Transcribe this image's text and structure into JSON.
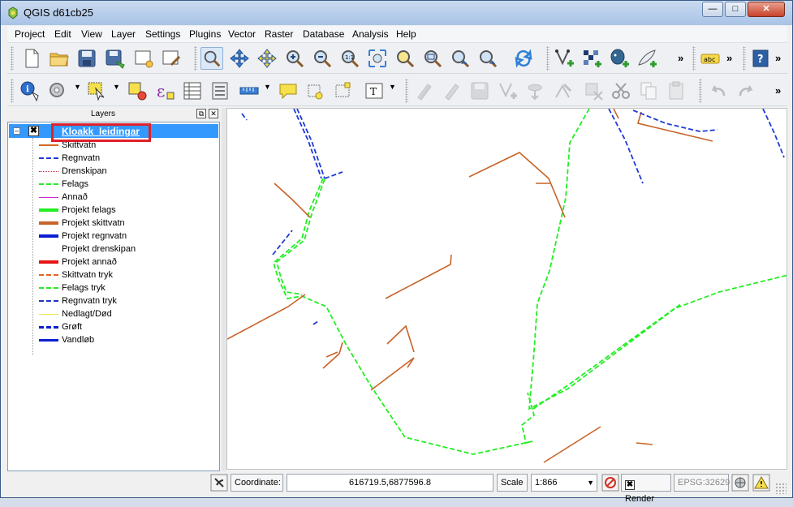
{
  "window": {
    "title": "QGIS d61cb25"
  },
  "menu": [
    "Project",
    "Edit",
    "View",
    "Layer",
    "Settings",
    "Plugins",
    "Vector",
    "Raster",
    "Database",
    "Analysis",
    "Help"
  ],
  "toolbar_more": "»",
  "toolbar_labels": {
    "label_tool": "abc",
    "help": "?",
    "text_annotation": "T"
  },
  "layers_panel": {
    "title": "Layers",
    "layer_name": "Kloakk_leidingar",
    "legend": [
      {
        "label": "Skittvatn",
        "color": "#d2691e",
        "style": "solid",
        "width": 2
      },
      {
        "label": "Regnvatn",
        "color": "#1f3ad6",
        "style": "dashed",
        "width": 2
      },
      {
        "label": "Drenskipan",
        "color": "#c8283c",
        "style": "dashdot",
        "width": 1
      },
      {
        "label": "Felags",
        "color": "#22ee22",
        "style": "dashed",
        "width": 2
      },
      {
        "label": "Annað",
        "color": "#c828c8",
        "style": "solid",
        "width": 1
      },
      {
        "label": "Projekt felags",
        "color": "#22ee22",
        "style": "solid",
        "width": 4
      },
      {
        "label": "Projekt skittvatn",
        "color": "#c86428",
        "style": "solid",
        "width": 4
      },
      {
        "label": "Projekt regnvatn",
        "color": "#0a1ed0",
        "style": "solid",
        "width": 4
      },
      {
        "label": "Projekt drenskipan",
        "color": "#ffffff",
        "style": "none",
        "width": 0
      },
      {
        "label": "Projekt annað",
        "color": "#e61414",
        "style": "solid",
        "width": 4
      },
      {
        "label": "Skittvatn tryk",
        "color": "#e6641e",
        "style": "dashed",
        "width": 2
      },
      {
        "label": "Felags tryk",
        "color": "#22ee22",
        "style": "dashed",
        "width": 2
      },
      {
        "label": "Regnvatn tryk",
        "color": "#1e32c8",
        "style": "dashed",
        "width": 2
      },
      {
        "label": "Nedlagt/Død",
        "color": "#f0e65a",
        "style": "solid",
        "width": 1
      },
      {
        "label": "Grøft",
        "color": "#0a1ed0",
        "style": "dashed",
        "width": 3
      },
      {
        "label": "Vandløb",
        "color": "#0a1ed0",
        "style": "solid",
        "width": 3
      }
    ]
  },
  "statusbar": {
    "coordinate_label": "Coordinate:",
    "coordinate_value": "616719.5,6877596.8",
    "scale_label": "Scale",
    "scale_value": "1:866",
    "render_label": "Render",
    "crs": "EPSG:32629"
  },
  "colors": {
    "selection": "#3399ff",
    "highlight_box": "#e0202a",
    "felags": "#22ee22",
    "skittvatn": "#c86428",
    "regnvatn": "#1f3ad6"
  }
}
